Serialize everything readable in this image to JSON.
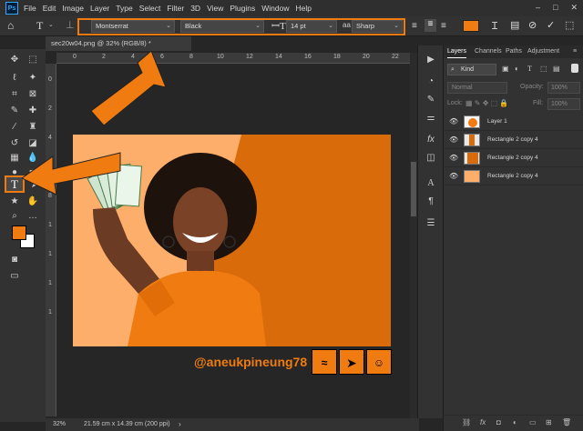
{
  "menubar": {
    "logo": "Ps",
    "items": [
      "File",
      "Edit",
      "Image",
      "Layer",
      "Type",
      "Select",
      "Filter",
      "3D",
      "View",
      "Plugins",
      "Window",
      "Help"
    ],
    "window_controls": [
      "–",
      "□",
      "✕"
    ]
  },
  "options": {
    "font_family": "Montserrat",
    "font_style": "Black",
    "font_size": "14 pt",
    "aa_label": "aa",
    "antialias": "Sharp",
    "color_hex": "#f07c11"
  },
  "document": {
    "tab_title": "sec20w04.png @ 32% (RGB/8) *",
    "ruler_top": [
      "0",
      "2",
      "4",
      "6",
      "8",
      "10",
      "12",
      "14",
      "16",
      "18",
      "20",
      "22"
    ],
    "ruler_left": [
      "0",
      "2",
      "4",
      "6",
      "8",
      "1",
      "1",
      "1",
      "1"
    ],
    "zoom": "32%",
    "doc_info": "21.59 cm x 14.39 cm (200 ppi)"
  },
  "artboard": {
    "handle": "@aneukpineung78",
    "colors": {
      "light_orange": "#fcae6a",
      "dark_orange": "#d96b0a",
      "brand": "#f07c11"
    }
  },
  "toolbar": {
    "foreground": "#f07c11",
    "background": "#ffffff"
  },
  "layers_panel": {
    "tabs": [
      "Layers",
      "Channels",
      "Paths",
      "Adjustment"
    ],
    "kind": "Kind",
    "blend_mode": "Normal",
    "opacity_label": "Opacity:",
    "opacity_value": "100%",
    "lock_label": "Lock:",
    "fill_label": "Fill:",
    "fill_value": "100%",
    "layers": [
      {
        "name": "Layer 1"
      },
      {
        "name": "Rectangle 2 copy 4"
      },
      {
        "name": "Rectangle 2 copy 4"
      },
      {
        "name": "Rectangle 2 copy 4"
      }
    ],
    "footer_icons": [
      "link-icon",
      "fx-icon",
      "mask-icon",
      "adjustment-icon",
      "group-icon",
      "new-layer-icon",
      "trash-icon"
    ]
  }
}
